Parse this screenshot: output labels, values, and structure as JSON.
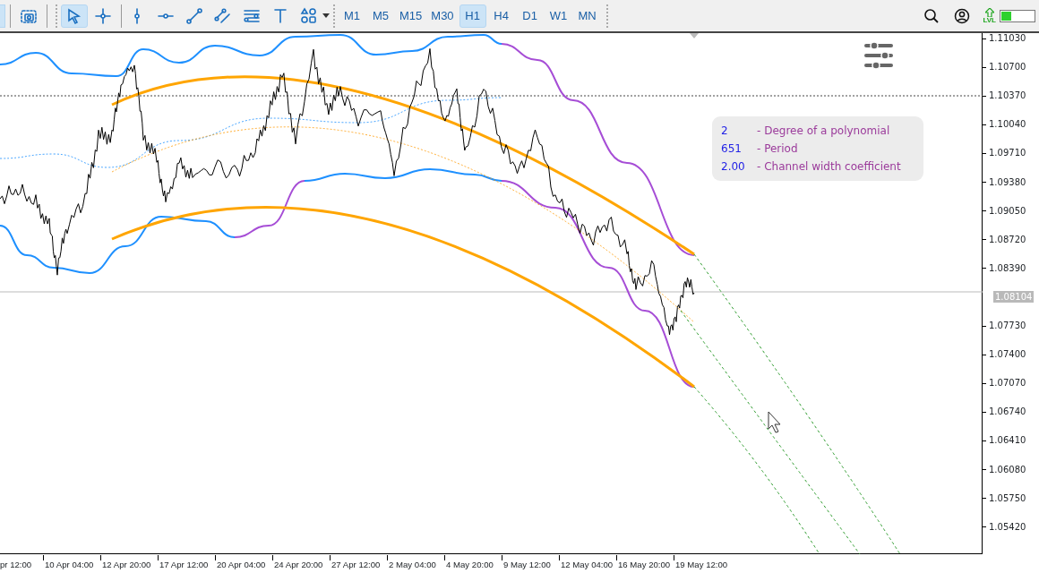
{
  "toolbar": {
    "tools": [
      {
        "kind": "screenshot",
        "selected": false
      },
      {
        "kind": "cursor",
        "selected": true
      },
      {
        "kind": "crosshair",
        "selected": false
      },
      {
        "kind": "vline",
        "selected": false
      },
      {
        "kind": "hline",
        "selected": false
      },
      {
        "kind": "trendline",
        "selected": false
      },
      {
        "kind": "channel",
        "selected": false
      },
      {
        "kind": "fibo",
        "selected": false
      },
      {
        "kind": "text",
        "selected": false
      },
      {
        "kind": "shapes",
        "selected": false
      }
    ],
    "timeframes": [
      {
        "label": "M1",
        "selected": false
      },
      {
        "label": "M5",
        "selected": false
      },
      {
        "label": "M15",
        "selected": false
      },
      {
        "label": "M30",
        "selected": false
      },
      {
        "label": "H1",
        "selected": true
      },
      {
        "label": "H4",
        "selected": false
      },
      {
        "label": "D1",
        "selected": false
      },
      {
        "label": "W1",
        "selected": false
      },
      {
        "label": "MN",
        "selected": false
      }
    ],
    "level_badge": "LVL",
    "signal": {
      "level": 0.3
    }
  },
  "info_panel": [
    {
      "value": "2",
      "description": "- Degree of a polynomial"
    },
    {
      "value": "651",
      "description": "- Period"
    },
    {
      "value": "2.00",
      "description": "- Channel width coefficient"
    }
  ],
  "price_axis": [
    {
      "kind": "tick",
      "text": "1.11030"
    },
    {
      "kind": "tick",
      "text": "1.10700"
    },
    {
      "kind": "tick",
      "text": "1.10370"
    },
    {
      "kind": "tick",
      "text": "1.10040"
    },
    {
      "kind": "tick",
      "text": "1.09710"
    },
    {
      "kind": "tick",
      "text": "1.09380"
    },
    {
      "kind": "tick",
      "text": "1.09050"
    },
    {
      "kind": "tick",
      "text": "1.08720"
    },
    {
      "kind": "tick",
      "text": "1.08390"
    },
    {
      "kind": "current",
      "text": "1.08104"
    },
    {
      "kind": "tick",
      "text": "1.07730"
    },
    {
      "kind": "tick",
      "text": "1.07400"
    },
    {
      "kind": "tick",
      "text": "1.07070"
    },
    {
      "kind": "tick",
      "text": "1.06740"
    },
    {
      "kind": "tick",
      "text": "1.06410"
    },
    {
      "kind": "tick",
      "text": "1.06080"
    },
    {
      "kind": "tick",
      "text": "1.05750"
    },
    {
      "kind": "tick",
      "text": "1.05420"
    }
  ],
  "time_axis": [
    "pr 12:00",
    "10 Apr 04:00",
    "12 Apr 20:00",
    "17 Apr 12:00",
    "20 Apr 04:00",
    "24 Apr 20:00",
    "27 Apr 12:00",
    "2 May 04:00",
    "4 May 20:00",
    "9 May 12:00",
    "12 May 04:00",
    "16 May 20:00",
    "19 May 12:00"
  ]
}
